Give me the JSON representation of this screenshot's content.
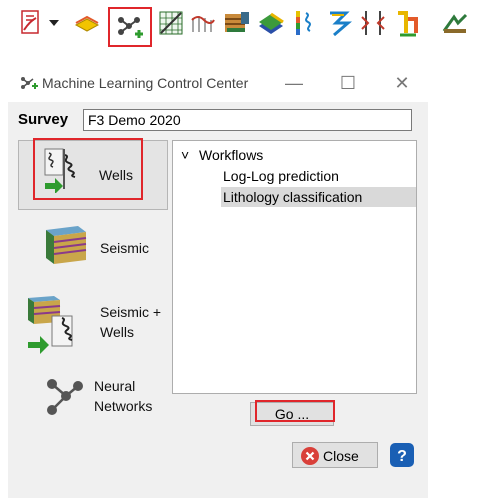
{
  "toolbar": {
    "icons": [
      "pdf-export-icon",
      "dropdown-arrow-icon",
      "horizon-layer-icon",
      "machine-learning-icon",
      "crossplot-grid-icon",
      "velocity-well-icon",
      "seismic-volume-icon",
      "layer-model-icon",
      "well-log-icon",
      "attribute-curve-icon",
      "well-correlation-icon",
      "log-tool-icon",
      "geobody-icon"
    ]
  },
  "window": {
    "title": "Machine Learning Control Center",
    "minimize_label": "—",
    "maximize_label": "☐",
    "close_label": "✕"
  },
  "survey": {
    "label": "Survey",
    "value": "F3 Demo 2020"
  },
  "sidebar": {
    "items": [
      {
        "label": "Wells"
      },
      {
        "label": "Seismic"
      },
      {
        "label_line1": "Seismic +",
        "label_line2": "Wells"
      },
      {
        "label_line1": "Neural",
        "label_line2": "Networks"
      }
    ]
  },
  "tree": {
    "root": "Workflows",
    "expand_glyph": "˅",
    "children": [
      "Log-Log prediction",
      "Lithology classification"
    ],
    "selected": "Lithology classification"
  },
  "buttons": {
    "go_label": "Go ...",
    "close_label": "Close",
    "help_label": "?"
  },
  "colors": {
    "highlight": "#e0262b",
    "selection": "#d9d9d9",
    "close_icon": "#d9403a",
    "help_icon": "#1a5fb4"
  }
}
